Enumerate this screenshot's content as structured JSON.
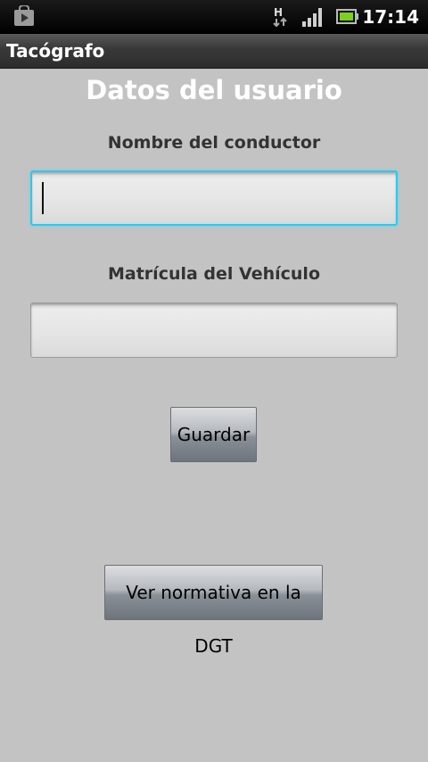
{
  "status_bar": {
    "time": "17:14",
    "network_type": "H",
    "icons": [
      "play-store-icon",
      "network-h-icon",
      "signal-icon",
      "battery-icon"
    ]
  },
  "app": {
    "title": "Tacógrafo"
  },
  "form": {
    "heading": "Datos del usuario",
    "driver_name": {
      "label": "Nombre del conductor",
      "value": "",
      "placeholder": ""
    },
    "vehicle_plate": {
      "label": "Matrícula del Vehículo",
      "value": "",
      "placeholder": ""
    },
    "save_label": "Guardar",
    "dgt_label": "Ver normativa en la DGT"
  },
  "colors": {
    "background": "#c3c3c3",
    "focus_accent": "#2ec8ec",
    "heading": "#ffffff"
  }
}
